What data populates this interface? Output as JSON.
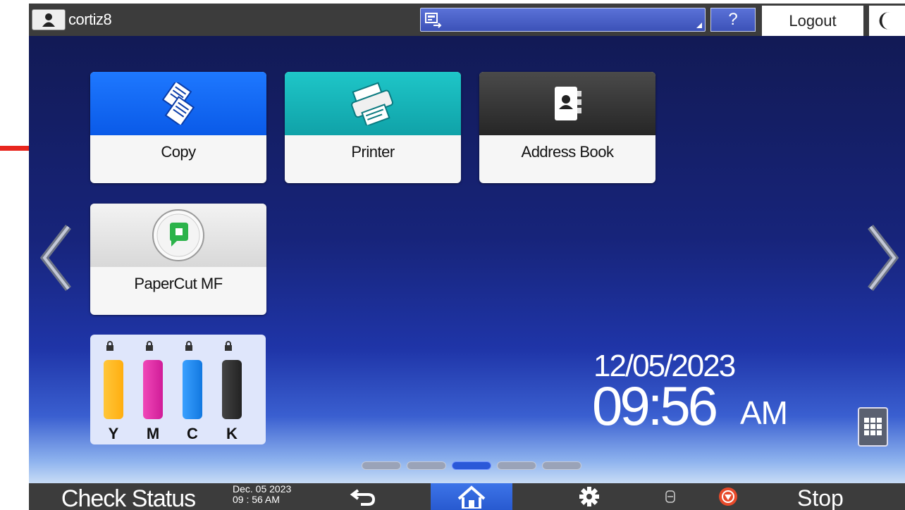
{
  "header": {
    "user_name": "cortiz8",
    "help_label": "?",
    "logout_label": "Logout"
  },
  "apps": [
    {
      "label": "Copy",
      "icon": "copy-icon"
    },
    {
      "label": "Printer",
      "icon": "printer-icon"
    },
    {
      "label": "Address Book",
      "icon": "address-book-icon"
    },
    {
      "label": "PaperCut MF",
      "icon": "papercut-icon"
    }
  ],
  "toner": {
    "cartridges": [
      {
        "label": "Y",
        "color": "#ffb81c"
      },
      {
        "label": "M",
        "color": "#e62aa8"
      },
      {
        "label": "C",
        "color": "#1e8cf0"
      },
      {
        "label": "K",
        "color": "#2b2b2b"
      }
    ]
  },
  "clock": {
    "date": "12/05/2023",
    "time": "09:56",
    "ampm": "AM"
  },
  "pager": {
    "pages": 5,
    "active": 2
  },
  "footer": {
    "check_status": "Check Status",
    "date_line1": "Dec. 05 2023",
    "date_line2": "09 : 56 AM",
    "stop_label": "Stop"
  },
  "colors": {
    "top_bar": "#3c3c3c",
    "copy_tile": "#1e78ff",
    "printer_tile": "#1ec6c8",
    "address_tile": "#333333",
    "annotation_arrow": "#e8261e",
    "stop_icon": "#e84a2a"
  }
}
